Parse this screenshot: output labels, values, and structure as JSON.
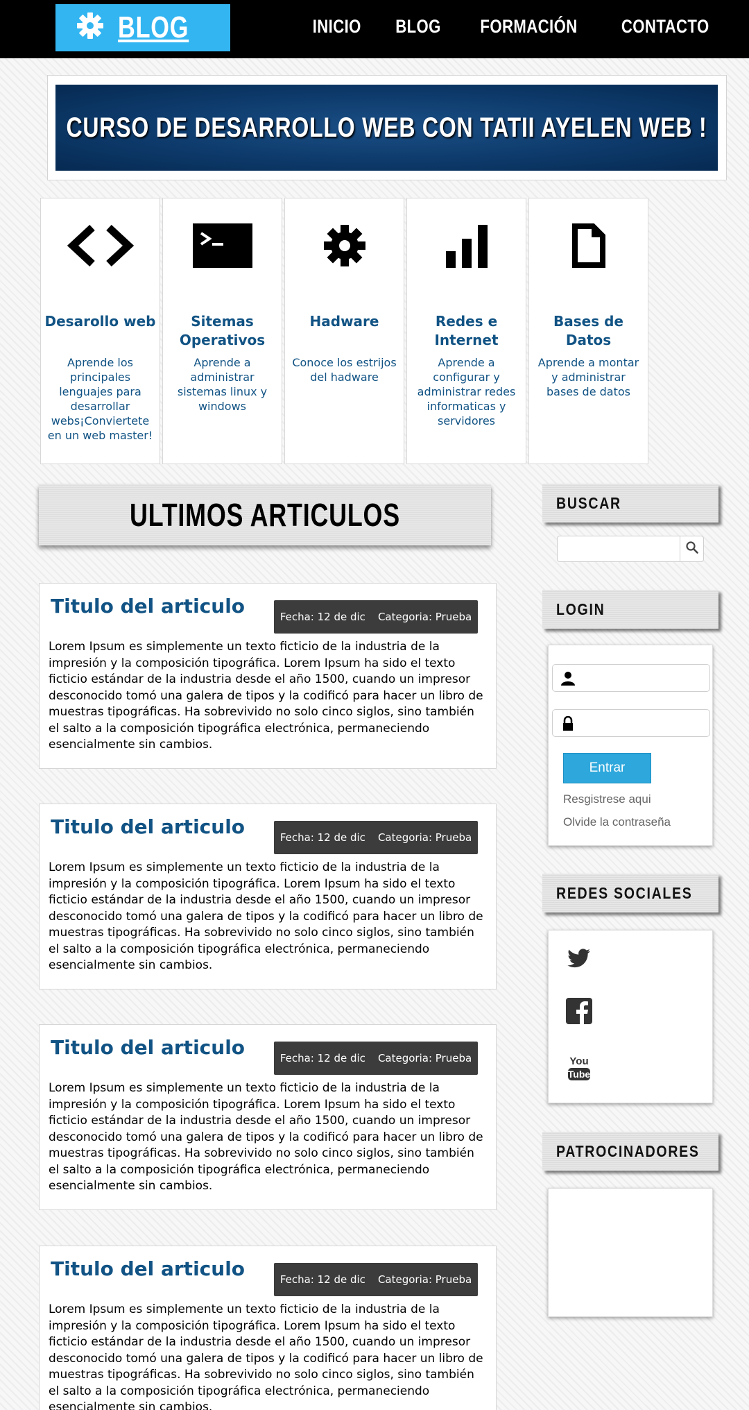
{
  "header": {
    "logo_icon": "gear-icon",
    "logo_text": "BLOG",
    "logo_color": "#33b5f1",
    "nav": [
      "INICIO",
      "BLOG",
      "FORMACIÓN",
      "CONTACTO"
    ]
  },
  "banner": {
    "title": "CURSO DE DESARROLLO WEB CON TATII AYELEN WEB !"
  },
  "features": [
    {
      "icon": "code-icon",
      "title": "Desarollo web",
      "desc": "Aprende los principales lenguajes para desarrollar webs¡Conviertete en un web master!"
    },
    {
      "icon": "terminal-icon",
      "title": "Sitemas Operativos",
      "desc": "Aprende a administrar sistemas linux y windows"
    },
    {
      "icon": "gear-icon",
      "title": "Hadware",
      "desc": "Conoce los estrijos del hadware"
    },
    {
      "icon": "signal-bars-icon",
      "title": "Redes e Internet",
      "desc": "Aprende a configurar y administrar redes informaticas y servidores"
    },
    {
      "icon": "document-icon",
      "title": "Bases de Datos",
      "desc": "Aprende a montar y administrar bases de datos"
    }
  ],
  "main": {
    "heading": "ULTIMOS ARTICULOS",
    "articles": [
      {
        "title": "Titulo del articulo",
        "fecha": "Fecha: 12 de dic",
        "categoria": "Categoria: Prueba",
        "body": "Lorem Ipsum es simplemente un texto ficticio de la industria de la impresión y la composición tipográfica. Lorem Ipsum ha sido el texto ficticio estándar de la industria desde el año 1500, cuando un impresor desconocido tomó una galera de tipos y la codificó para hacer un libro de muestras tipográficas. Ha sobrevivido no solo cinco siglos, sino también el salto a la composición tipográfica electrónica, permaneciendo esencialmente sin cambios."
      },
      {
        "title": "Titulo del articulo",
        "fecha": "Fecha: 12 de dic",
        "categoria": "Categoria: Prueba",
        "body": "Lorem Ipsum es simplemente un texto ficticio de la industria de la impresión y la composición tipográfica. Lorem Ipsum ha sido el texto ficticio estándar de la industria desde el año 1500, cuando un impresor desconocido tomó una galera de tipos y la codificó para hacer un libro de muestras tipográficas. Ha sobrevivido no solo cinco siglos, sino también el salto a la composición tipográfica electrónica, permaneciendo esencialmente sin cambios."
      },
      {
        "title": "Titulo del articulo",
        "fecha": "Fecha: 12 de dic",
        "categoria": "Categoria: Prueba",
        "body": "Lorem Ipsum es simplemente un texto ficticio de la industria de la impresión y la composición tipográfica. Lorem Ipsum ha sido el texto ficticio estándar de la industria desde el año 1500, cuando un impresor desconocido tomó una galera de tipos y la codificó para hacer un libro de muestras tipográficas. Ha sobrevivido no solo cinco siglos, sino también el salto a la composición tipográfica electrónica, permaneciendo esencialmente sin cambios."
      },
      {
        "title": "Titulo del articulo",
        "fecha": "Fecha: 12 de dic",
        "categoria": "Categoria: Prueba",
        "body": "Lorem Ipsum es simplemente un texto ficticio de la industria de la impresión y la composición tipográfica. Lorem Ipsum ha sido el texto ficticio estándar de la industria desde el año 1500, cuando un impresor desconocido tomó una galera de tipos y la codificó para hacer un libro de muestras tipográficas. Ha sobrevivido no solo cinco siglos, sino también el salto a la composición tipográfica electrónica, permaneciendo esencialmente sin cambios."
      }
    ]
  },
  "sidebar": {
    "search": {
      "heading": "BUSCAR",
      "value": "",
      "icon": "search-icon"
    },
    "login": {
      "heading": "LOGIN",
      "user_icon": "user-icon",
      "password_icon": "lock-icon",
      "button": "Entrar",
      "register_link": "Resgistrese aqui",
      "forgot_link": "Olvide la contraseña",
      "button_color": "#2ea8dc"
    },
    "social": {
      "heading": "REDES SOCIALES",
      "icons": [
        "twitter-icon",
        "facebook-icon",
        "youtube-icon"
      ]
    },
    "sponsors": {
      "heading": "PATROCINADORES"
    }
  }
}
